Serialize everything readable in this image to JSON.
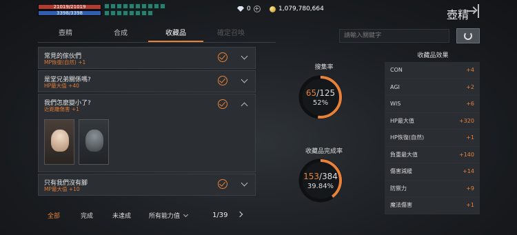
{
  "status": {
    "hp": "21019/21019",
    "mp": "3398/3398",
    "crystals": "0",
    "gold": "1,079,780,664"
  },
  "buff_icons": [
    "buff-icon",
    "buff-icon",
    "buff-icon",
    "buff-icon",
    "buff-icon",
    "buff-icon",
    "buff-icon",
    "buff-icon",
    "buff-icon",
    "buff-icon",
    "buff-icon",
    "buff-icon",
    "buff-icon",
    "buff-icon",
    "buff-icon",
    "buff-icon",
    "buff-icon",
    "buff-icon"
  ],
  "window_title": "壺精",
  "tabs": [
    {
      "label": "壺精"
    },
    {
      "label": "合成"
    },
    {
      "label": "收藏品"
    },
    {
      "label": "確定召喚"
    }
  ],
  "search": {
    "placeholder": "請輸入關鍵字"
  },
  "collections": [
    {
      "name": "常見的傢伙們",
      "effect": "MP恢復(自然) +1"
    },
    {
      "name": "是堂兄弟關係嗎?",
      "effect": "HP最大值 +40"
    },
    {
      "name": "我們怎麼變小了?",
      "effect": "近距離傷害 +1"
    },
    {
      "name": "只有我們沒有腳",
      "effect": "MP最大值 +10"
    }
  ],
  "filters": {
    "all": "全部",
    "completed": "完成",
    "incomplete": "未達成",
    "stat_filter": "所有能力值",
    "page": "1/39"
  },
  "gauges": {
    "collect": {
      "title": "搜集率",
      "current": "65",
      "total": "/125",
      "percent": "52%",
      "fraction": 0.52
    },
    "complete": {
      "title": "收藏品完成率",
      "current": "153",
      "total": "/384",
      "percent": "39.84%",
      "fraction": 0.3984
    }
  },
  "effects": {
    "title": "收藏品效果",
    "rows": [
      {
        "label": "CON",
        "value": "+4"
      },
      {
        "label": "AGI",
        "value": "+2"
      },
      {
        "label": "WIS",
        "value": "+6"
      },
      {
        "label": "HP最大值",
        "value": "+320"
      },
      {
        "label": "HP恢復(自然)",
        "value": "+1"
      },
      {
        "label": "負重最大值",
        "value": "+140"
      },
      {
        "label": "傷害減緩",
        "value": "+14"
      },
      {
        "label": "防禦力",
        "value": "+9"
      },
      {
        "label": "魔法傷害",
        "value": "+1"
      }
    ]
  },
  "colors": {
    "accent": "#e8823a",
    "hp": "#b23a2e",
    "mp": "#2f5fae"
  }
}
